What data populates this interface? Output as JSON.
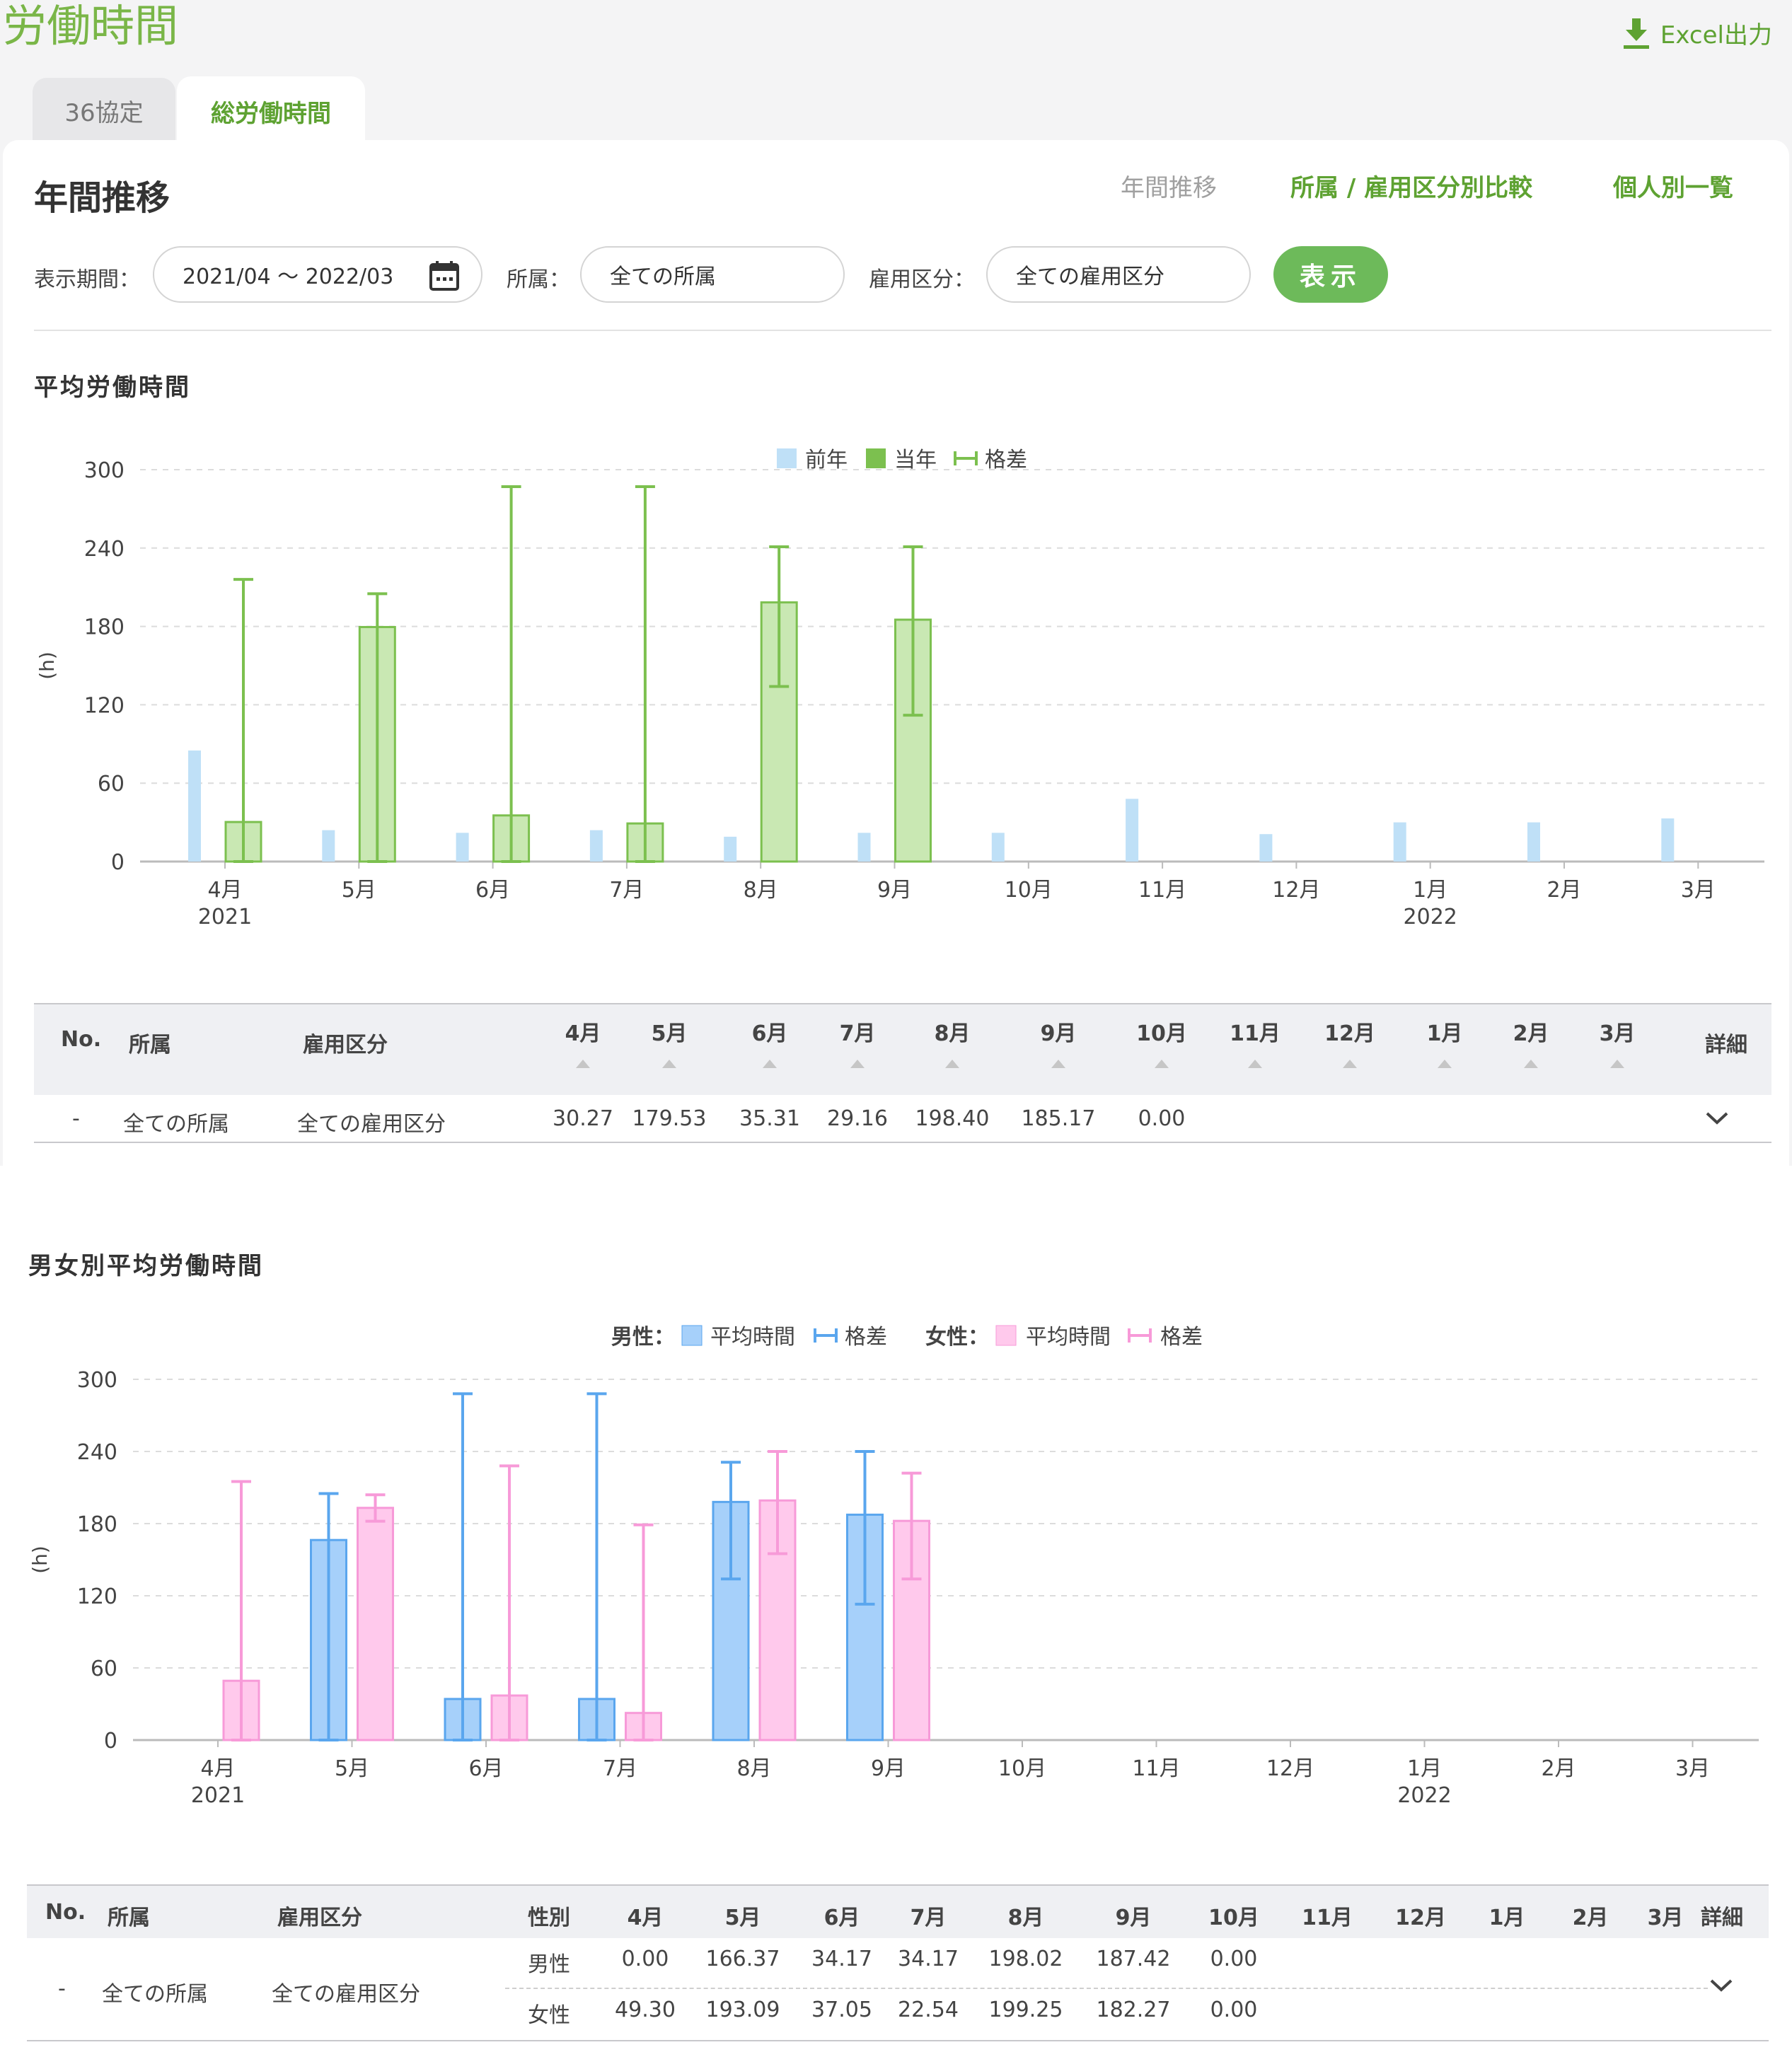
{
  "page": {
    "title": "労働時間",
    "excel_label": "Excel出力"
  },
  "tabs": [
    {
      "label": "36協定"
    },
    {
      "label": "総労働時間"
    }
  ],
  "header": {
    "title": "年間推移"
  },
  "subnav": [
    {
      "label": "年間推移"
    },
    {
      "label": "所属 / 雇用区分別比較"
    },
    {
      "label": "個人別一覧"
    }
  ],
  "filters": {
    "period_label": "表示期間：",
    "period_value": "2021/04 ～ 2022/03",
    "dept_label": "所属：",
    "dept_value": "全ての所属",
    "emp_label": "雇用区分：",
    "emp_value": "全ての雇用区分",
    "show_label": "表示"
  },
  "colors": {
    "accent": "#6dba5a",
    "prev_bar": "#bfe0f7",
    "cur_bar": "#c9e8b3",
    "cur_border": "#7cc04f",
    "male": "#a6d0fa",
    "male_border": "#5aa6ee",
    "female": "#ffc9ec",
    "female_border": "#f79ad8"
  },
  "avg_section": {
    "title": "平均労働時間"
  },
  "gender_section": {
    "title": "男女別平均労働時間"
  },
  "legend1": {
    "prev": "前年",
    "cur": "当年",
    "diff": "格差"
  },
  "legend2": {
    "male_label": "男性：",
    "male_avg": "平均時間",
    "male_diff": "格差",
    "female_label": "女性：",
    "female_avg": "平均時間",
    "female_diff": "格差"
  },
  "chart_data": [
    {
      "type": "bar",
      "ylabel": "(h)",
      "ylim": [
        0,
        300
      ],
      "yticks": [
        "0",
        "60",
        "120",
        "180",
        "240",
        "300"
      ],
      "categories": [
        "4月",
        "5月",
        "6月",
        "7月",
        "8月",
        "9月",
        "10月",
        "11月",
        "12月",
        "1月",
        "2月",
        "3月"
      ],
      "year_labels": {
        "0": "2021",
        "9": "2022"
      },
      "grid": true,
      "legend": "top-center",
      "series": [
        {
          "name": "前年",
          "values": [
            85,
            24,
            22,
            24,
            19,
            22,
            22,
            48,
            21,
            30,
            30,
            33
          ]
        },
        {
          "name": "当年",
          "values": [
            30.27,
            179.53,
            35.31,
            29.16,
            198.4,
            185.17,
            null,
            null,
            null,
            null,
            null,
            null
          ]
        },
        {
          "name": "格差",
          "ranges": [
            [
              0,
              216
            ],
            [
              0,
              205
            ],
            [
              0,
              287
            ],
            [
              0,
              287
            ],
            [
              134,
              241
            ],
            [
              112,
              241
            ],
            null,
            null,
            null,
            null,
            null,
            null
          ]
        }
      ]
    },
    {
      "type": "bar",
      "ylabel": "(h)",
      "ylim": [
        0,
        300
      ],
      "yticks": [
        "0",
        "60",
        "120",
        "180",
        "240",
        "300"
      ],
      "categories": [
        "4月",
        "5月",
        "6月",
        "7月",
        "8月",
        "9月",
        "10月",
        "11月",
        "12月",
        "1月",
        "2月",
        "3月"
      ],
      "year_labels": {
        "0": "2021",
        "9": "2022"
      },
      "grid": true,
      "legend": "top-center",
      "series": [
        {
          "name": "男性 平均時間",
          "values": [
            0.0,
            166.37,
            34.17,
            34.17,
            198.02,
            187.42,
            null,
            null,
            null,
            null,
            null,
            null
          ]
        },
        {
          "name": "男性 格差",
          "ranges": [
            null,
            [
              0,
              205
            ],
            [
              0,
              288
            ],
            [
              0,
              288
            ],
            [
              134,
              231
            ],
            [
              113,
              240
            ],
            null,
            null,
            null,
            null,
            null,
            null
          ]
        },
        {
          "name": "女性 平均時間",
          "values": [
            49.3,
            193.09,
            37.05,
            22.54,
            199.25,
            182.27,
            null,
            null,
            null,
            null,
            null,
            null
          ]
        },
        {
          "name": "女性 格差",
          "ranges": [
            [
              0,
              215
            ],
            [
              182,
              204
            ],
            [
              0,
              228
            ],
            [
              0,
              179
            ],
            [
              155,
              240
            ],
            [
              134,
              222
            ],
            null,
            null,
            null,
            null,
            null,
            null
          ]
        }
      ]
    }
  ],
  "table1": {
    "headers": [
      "No.",
      "所属",
      "雇用区分",
      "4月",
      "5月",
      "6月",
      "7月",
      "8月",
      "9月",
      "10月",
      "11月",
      "12月",
      "1月",
      "2月",
      "3月",
      "詳細"
    ],
    "rows": [
      {
        "no": "-",
        "dept": "全ての所属",
        "emp": "全ての雇用区分",
        "values": [
          "30.27",
          "179.53",
          "35.31",
          "29.16",
          "198.40",
          "185.17",
          "0.00",
          "",
          "",
          "",
          "",
          ""
        ]
      }
    ]
  },
  "table2": {
    "headers": [
      "No.",
      "所属",
      "雇用区分",
      "性別",
      "4月",
      "5月",
      "6月",
      "7月",
      "8月",
      "9月",
      "10月",
      "11月",
      "12月",
      "1月",
      "2月",
      "3月",
      "詳細"
    ],
    "rows": [
      {
        "no": "-",
        "dept": "全ての所属",
        "emp": "全ての雇用区分",
        "male_label": "男性",
        "male": [
          "0.00",
          "166.37",
          "34.17",
          "34.17",
          "198.02",
          "187.42",
          "0.00",
          "",
          "",
          "",
          "",
          ""
        ],
        "female_label": "女性",
        "female": [
          "49.30",
          "193.09",
          "37.05",
          "22.54",
          "199.25",
          "182.27",
          "0.00",
          "",
          "",
          "",
          "",
          ""
        ]
      }
    ]
  }
}
